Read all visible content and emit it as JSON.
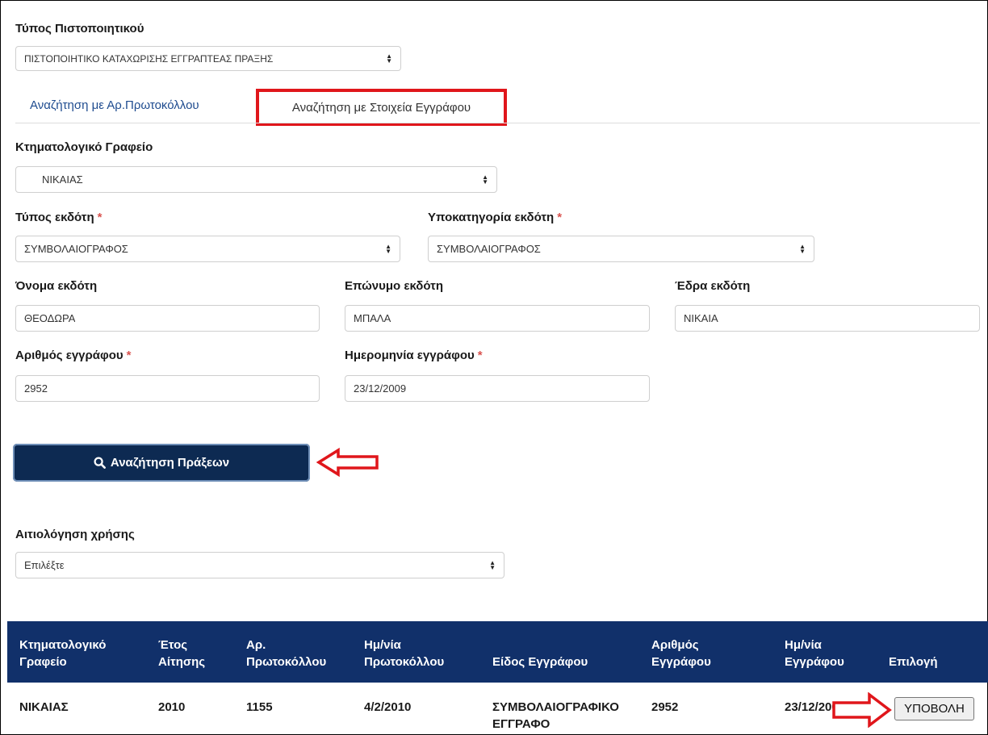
{
  "cert_type": {
    "label": "Τύπος Πιστοποιητικού",
    "value": "ΠΙΣΤΟΠΟΙΗΤΙΚΟ ΚΑΤΑΧΩΡΙΣΗΣ ΕΓΓΡΑΠΤΕΑΣ ΠΡΑΞΗΣ"
  },
  "tabs": [
    {
      "label": "Αναζήτηση με Αρ.Πρωτοκόλλου"
    },
    {
      "label": "Αναζήτηση με Στοιχεία Εγγράφου"
    }
  ],
  "form": {
    "office": {
      "label": "Κτηματολογικό Γραφείο",
      "value": "ΝΙΚΑΙΑΣ"
    },
    "issuer_type": {
      "label": "Τύπος εκδότη",
      "value": "ΣΥΜΒΟΛΑΙΟΓΡΑΦΟΣ"
    },
    "issuer_subcategory": {
      "label": "Υποκατηγορία εκδότη",
      "value": "ΣΥΜΒΟΛΑΙΟΓΡΑΦΟΣ"
    },
    "issuer_first_name": {
      "label": "Όνομα εκδότη",
      "value": "ΘΕΟΔΩΡΑ"
    },
    "issuer_last_name": {
      "label": "Επώνυμο εκδότη",
      "value": "ΜΠΑΛΑ"
    },
    "issuer_seat": {
      "label": "Έδρα εκδότη",
      "value": "ΝΙΚΑΙΑ"
    },
    "doc_number": {
      "label": "Αριθμός εγγράφου",
      "value": "2952"
    },
    "doc_date": {
      "label": "Ημερομηνία εγγράφου",
      "value": "23/12/2009"
    },
    "required_mark": "*"
  },
  "search_button": {
    "label": "Αναζήτηση Πράξεων",
    "icon": "search-icon"
  },
  "usage_reason": {
    "label": "Αιτιολόγηση χρήσης",
    "value": "Επιλέξτε"
  },
  "table": {
    "headers": [
      [
        "Κτηματολογικό",
        "Γραφείο"
      ],
      [
        "Έτος",
        "Αίτησης"
      ],
      [
        "Αρ.",
        "Πρωτοκόλλου"
      ],
      [
        "Ημ/νία",
        "Πρωτοκόλλου"
      ],
      [
        "",
        "Είδος Εγγράφου"
      ],
      [
        "Αριθμός",
        "Εγγράφου"
      ],
      [
        "Ημ/νία",
        "Εγγράφου"
      ],
      [
        "",
        "Επιλογή"
      ]
    ],
    "rows": [
      {
        "office": "ΝΙΚΑΙΑΣ",
        "year": "2010",
        "protocol_no": "1155",
        "protocol_date": "4/2/2010",
        "doc_type": [
          "ΣΥΜΒΟΛΑΙΟΓΡΑΦΙΚΟ",
          "ΕΓΓΡΑΦΟ"
        ],
        "doc_no": "2952",
        "doc_date": "23/12/2009",
        "action": "ΥΠΟΒΟΛΗ"
      }
    ]
  },
  "colors": {
    "accent_red": "#e0161b",
    "header_navy": "#11306a",
    "button_navy": "#0d2a52"
  }
}
